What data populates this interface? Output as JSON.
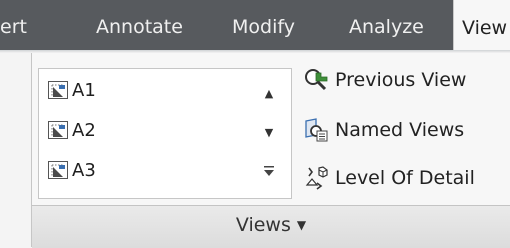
{
  "tabs": [
    {
      "label": "ert",
      "active": false
    },
    {
      "label": "Annotate",
      "active": false
    },
    {
      "label": "Modify",
      "active": false
    },
    {
      "label": "Analyze",
      "active": false
    },
    {
      "label": "View",
      "active": true
    }
  ],
  "panel": {
    "title": "Views",
    "views_list": [
      {
        "label": "A1",
        "icon": "viewport-icon"
      },
      {
        "label": "A2",
        "icon": "viewport-icon"
      },
      {
        "label": "A3",
        "icon": "viewport-icon"
      }
    ],
    "scroll_up_icon": "triangle-up-icon",
    "scroll_down_icon": "triangle-down-icon",
    "expand_icon": "expand-gallery-icon",
    "buttons": {
      "previous_view": {
        "label": "Previous View",
        "icon": "previous-view-icon"
      },
      "named_views": {
        "label": "Named Views",
        "icon": "named-views-icon"
      },
      "level_of_detail": {
        "label": "Level Of Detail",
        "icon": "level-of-detail-icon"
      }
    },
    "panel_menu_icon": "dropdown-arrow-icon"
  },
  "colors": {
    "tabbar_bg": "#575a5e",
    "tab_text": "#f0f0f0",
    "panel_bg": "#f7f7f7",
    "icon_blue": "#3a6fb0",
    "icon_green": "#3f8f3a"
  }
}
